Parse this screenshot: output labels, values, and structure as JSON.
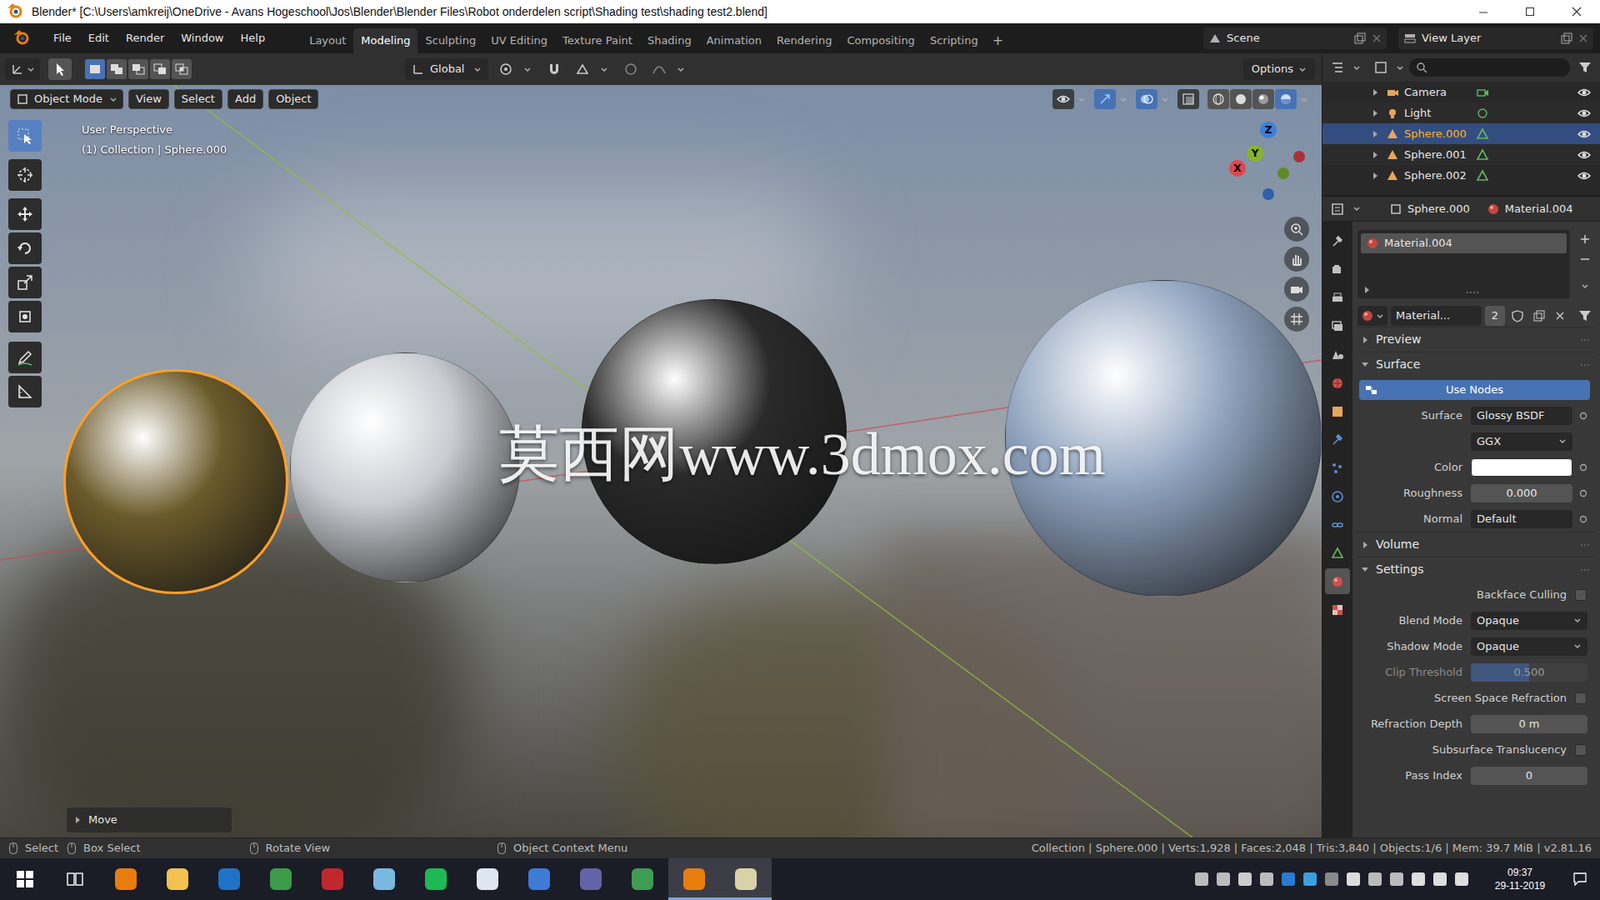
{
  "window": {
    "title": "Blender* [C:\\Users\\amkreij\\OneDrive - Avans Hogeschool\\Jos\\Blender\\Blender Files\\Robot onderdelen script\\Shading test\\shading test2.blend]"
  },
  "menus": [
    "File",
    "Edit",
    "Render",
    "Window",
    "Help"
  ],
  "workspaces": [
    {
      "label": "Layout",
      "selected": false
    },
    {
      "label": "Modeling",
      "selected": true
    },
    {
      "label": "Sculpting",
      "selected": false
    },
    {
      "label": "UV Editing",
      "selected": false
    },
    {
      "label": "Texture Paint",
      "selected": false
    },
    {
      "label": "Shading",
      "selected": false
    },
    {
      "label": "Animation",
      "selected": false
    },
    {
      "label": "Rendering",
      "selected": false
    },
    {
      "label": "Compositing",
      "selected": false
    },
    {
      "label": "Scripting",
      "selected": false
    }
  ],
  "add_workspace": "+",
  "scene": "Scene",
  "view_layer": "View Layer",
  "tool_header": {
    "select_modes": [
      {
        "kind": "set",
        "selected": true
      },
      {
        "kind": "extend",
        "selected": false
      },
      {
        "kind": "subtract",
        "selected": false
      },
      {
        "kind": "difference",
        "selected": false
      },
      {
        "kind": "intersect",
        "selected": false
      }
    ],
    "orientation": "Global",
    "options": "Options"
  },
  "viewport": {
    "mode": "Object Mode",
    "menus": [
      "View",
      "Select",
      "Add",
      "Object"
    ],
    "shading_modes": [
      {
        "kind": "wireframe",
        "selected": false
      },
      {
        "kind": "solid",
        "selected": false
      },
      {
        "kind": "material",
        "selected": false
      },
      {
        "kind": "rendered",
        "selected": true
      }
    ],
    "perspective": "User Perspective",
    "context": "(1) Collection | Sphere.000",
    "tools": [
      {
        "kind": "select",
        "selected": true
      },
      {
        "kind": "cursor",
        "selected": false
      },
      {
        "kind": "move",
        "selected": false
      },
      {
        "kind": "rotate",
        "selected": false
      },
      {
        "kind": "scale",
        "selected": false
      },
      {
        "kind": "transform",
        "selected": false
      },
      {
        "kind": "annotate",
        "selected": false
      },
      {
        "kind": "measure",
        "selected": false
      }
    ],
    "gizmo": [
      {
        "label": "X",
        "color": "#e2454f"
      },
      {
        "label": "Y",
        "color": "#86b52a"
      },
      {
        "label": "Z",
        "color": "#3b7fd9"
      }
    ],
    "spheres": [
      {
        "color": "#6b5a2a",
        "selected": true
      },
      {
        "color": "#c9ccd2",
        "selected": false
      },
      {
        "color": "#2a2a2a",
        "selected": false
      },
      {
        "color": "#8fa3bf",
        "selected": false
      }
    ],
    "watermark": "莫西网www.3dmox.com",
    "last_operator": "Move"
  },
  "outliner": {
    "items": [
      {
        "label": "Camera",
        "kind": "camera",
        "selected": false,
        "visible": true
      },
      {
        "label": "Light",
        "kind": "light",
        "selected": false,
        "visible": true
      },
      {
        "label": "Sphere.000",
        "kind": "mesh",
        "selected": true,
        "visible": true
      },
      {
        "label": "Sphere.001",
        "kind": "mesh",
        "selected": false,
        "visible": true
      },
      {
        "label": "Sphere.002",
        "kind": "mesh",
        "selected": false,
        "visible": true
      }
    ]
  },
  "properties": {
    "tabs": [
      {
        "kind": "tool",
        "selected": false
      },
      {
        "kind": "render",
        "selected": false
      },
      {
        "kind": "output",
        "selected": false
      },
      {
        "kind": "view_layer",
        "selected": false
      },
      {
        "kind": "scene",
        "selected": false
      },
      {
        "kind": "world",
        "selected": false
      },
      {
        "kind": "object",
        "selected": false
      },
      {
        "kind": "modifiers",
        "selected": false
      },
      {
        "kind": "particles",
        "selected": false
      },
      {
        "kind": "physics",
        "selected": false
      },
      {
        "kind": "constraints",
        "selected": false
      },
      {
        "kind": "data",
        "selected": false
      },
      {
        "kind": "material",
        "selected": true
      },
      {
        "kind": "texture",
        "selected": false
      }
    ],
    "object": "Sphere.000",
    "material": "Material.004",
    "slots": [
      {
        "label": "Material.004",
        "selected": true
      }
    ],
    "datablock": {
      "name": "Material...",
      "users": "2"
    },
    "panels": [
      {
        "label": "Preview",
        "expanded": false,
        "rows": []
      },
      {
        "label": "Surface",
        "expanded": true,
        "rows": [
          {
            "kind": "button",
            "label": "Use Nodes",
            "selected": true
          },
          {
            "kind": "dropdown",
            "label": "Surface",
            "value": "Glossy BSDF",
            "socket": true
          },
          {
            "kind": "dropdown",
            "value": "GGX",
            "socket": false
          },
          {
            "kind": "color",
            "label": "Color",
            "color": "#ffffff",
            "socket": true
          },
          {
            "kind": "slider",
            "label": "Roughness",
            "value": "0.000",
            "level": 0,
            "disabled": false,
            "socket": true
          },
          {
            "kind": "dropdown",
            "label": "Normal",
            "value": "Default",
            "socket": true
          }
        ]
      },
      {
        "label": "Volume",
        "expanded": false,
        "rows": []
      },
      {
        "label": "Settings",
        "expanded": true,
        "rows": [
          {
            "kind": "checkbox",
            "label": "Backface Culling",
            "checked": false
          },
          {
            "kind": "dropdown",
            "label": "Blend Mode",
            "value": "Opaque"
          },
          {
            "kind": "dropdown",
            "label": "Shadow Mode",
            "value": "Opaque"
          },
          {
            "kind": "slider",
            "label": "Clip Threshold",
            "value": "0.500",
            "level": 0.5,
            "disabled": true
          },
          {
            "kind": "checkbox",
            "label": "Screen Space Refraction",
            "checked": false
          },
          {
            "kind": "number",
            "label": "Refraction Depth",
            "value": "0 m"
          },
          {
            "kind": "checkbox",
            "label": "Subsurface Translucency",
            "checked": false
          },
          {
            "kind": "number",
            "label": "Pass Index",
            "value": "0"
          }
        ]
      }
    ]
  },
  "status_bar": {
    "hints": [
      "Select",
      "Box Select",
      "Rotate View",
      "Object Context Menu"
    ],
    "info": "Collection | Sphere.000 | Verts:1,928 | Faces:2,048 | Tris:3,840 | Objects:1/6 | Mem: 39.7 MiB | v2.81.16"
  },
  "taskbar": {
    "apps": [
      {
        "color": "#e87d0d",
        "selected": false
      },
      {
        "color": "#f2c14e",
        "selected": false
      },
      {
        "color": "#1e72c8",
        "selected": false
      },
      {
        "color": "#3c9a4a",
        "selected": false
      },
      {
        "color": "#c0282d",
        "selected": false
      },
      {
        "color": "#7ab8e0",
        "selected": false
      },
      {
        "color": "#1db954",
        "selected": false
      },
      {
        "color": "#dfe6f0",
        "selected": false
      },
      {
        "color": "#3d7bd6",
        "selected": false
      },
      {
        "color": "#6264a7",
        "selected": false
      },
      {
        "color": "#3f9c52",
        "selected": false
      },
      {
        "color": "#e87d0d",
        "selected": true
      },
      {
        "color": "#d9d2a8",
        "selected": true
      }
    ],
    "time": "09:37",
    "date": "29-11-2019"
  }
}
